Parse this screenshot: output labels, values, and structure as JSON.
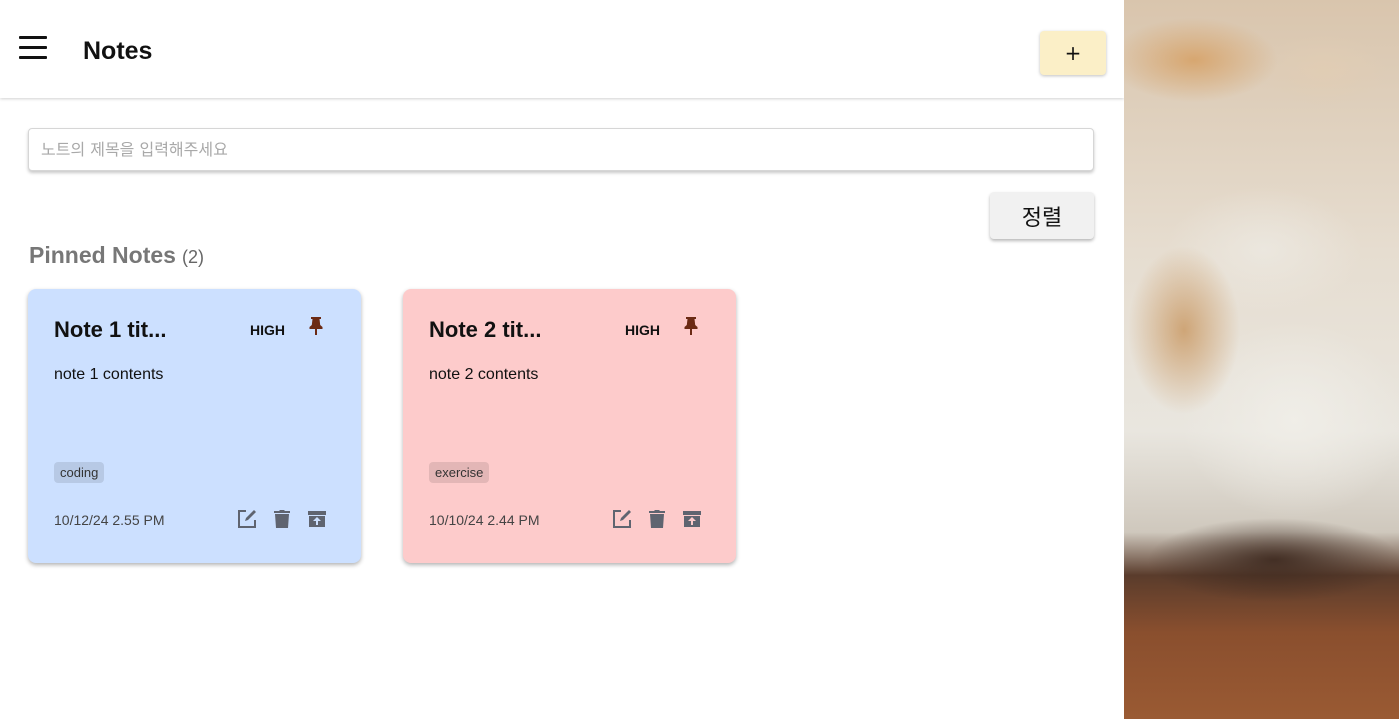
{
  "header": {
    "title": "Notes",
    "add_label": "+"
  },
  "search": {
    "placeholder": "노트의 제목을 입력해주세요",
    "value": ""
  },
  "sort": {
    "label": "정렬"
  },
  "section": {
    "title": "Pinned Notes",
    "count": "(2)"
  },
  "notes": [
    {
      "title": "Note 1 tit...",
      "priority": "HIGH",
      "content": "note 1 contents",
      "tag": "coding",
      "date": "10/12/24 2.55 PM",
      "color": "#cce0ff"
    },
    {
      "title": "Note 2 tit...",
      "priority": "HIGH",
      "content": "note 2 contents",
      "tag": "exercise",
      "date": "10/10/24 2.44 PM",
      "color": "#fdcbcb"
    }
  ],
  "colors": {
    "add_button": "#fbefc7",
    "pin": "#6b2a14",
    "action_icon": "#5f6470"
  },
  "icons": [
    "menu-icon",
    "pin-icon",
    "edit-icon",
    "trash-icon",
    "archive-icon"
  ]
}
